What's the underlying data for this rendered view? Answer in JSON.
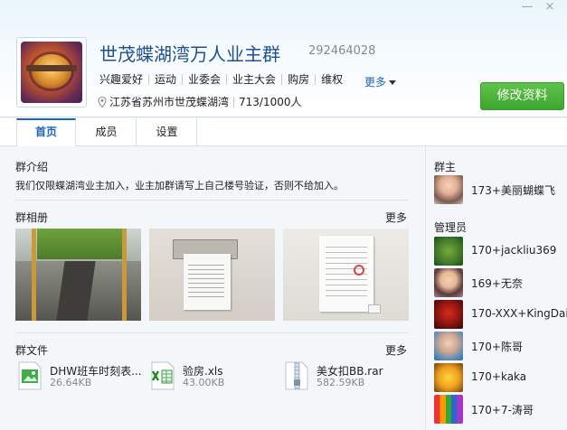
{
  "window": {
    "minimize": "—",
    "close": "×"
  },
  "header": {
    "group_name": "世茂蝶湖湾万人业主群",
    "group_id": "292464028",
    "tags": [
      "兴趣爱好",
      "运动",
      "业委会",
      "业主大会",
      "购房",
      "维权"
    ],
    "more_label": "更多",
    "location": "江苏省苏州市世茂蝶湖湾",
    "member_count": "713/1000人",
    "edit_button": "修改资料"
  },
  "tabs": [
    {
      "label": "首页",
      "active": true
    },
    {
      "label": "成员",
      "active": false
    },
    {
      "label": "设置",
      "active": false
    }
  ],
  "intro": {
    "title": "群介绍",
    "text": "我们仅限蝶湖湾业主加入，业主加群请写上自己楼号验证，否则不给加入。"
  },
  "album": {
    "title": "群相册",
    "more": "更多"
  },
  "files": {
    "title": "群文件",
    "more": "更多",
    "items": [
      {
        "name": "DHW班车时刻表...",
        "size": "26.64KB",
        "icon": "image-file-icon"
      },
      {
        "name": "验房.xls",
        "size": "43.00KB",
        "icon": "excel-file-icon"
      },
      {
        "name": "美女扣BB.rar",
        "size": "582.59KB",
        "icon": "rar-file-icon"
      }
    ]
  },
  "owner": {
    "title": "群主",
    "name": "173+美丽蝴蝶飞"
  },
  "admins": {
    "title": "管理员",
    "items": [
      "170+jackliu369",
      "169+无奈",
      "170-XXX+KingDai",
      "170+陈哥",
      "170+kaka",
      "170+7-涛哥"
    ]
  },
  "colors": {
    "accent": "#1d64b4",
    "button": "#3ea62f"
  }
}
